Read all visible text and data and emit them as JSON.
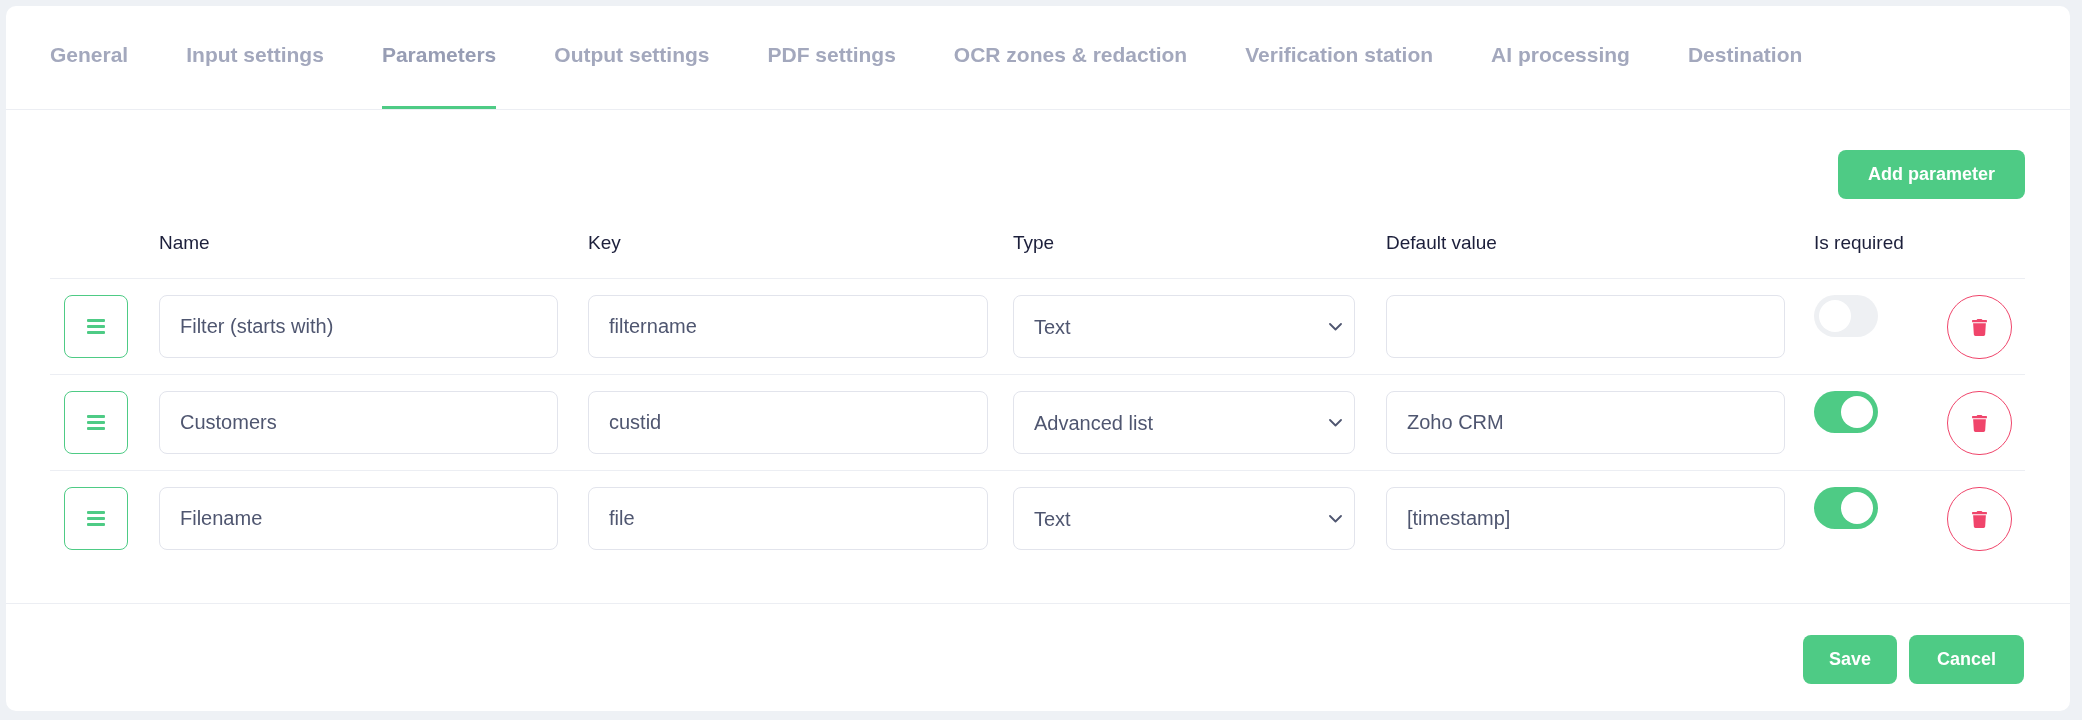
{
  "tabs": [
    {
      "label": "General",
      "selected": false
    },
    {
      "label": "Input settings",
      "selected": false
    },
    {
      "label": "Parameters",
      "selected": true
    },
    {
      "label": "Output settings",
      "selected": false
    },
    {
      "label": "PDF settings",
      "selected": false
    },
    {
      "label": "OCR zones & redaction",
      "selected": false
    },
    {
      "label": "Verification station",
      "selected": false
    },
    {
      "label": "AI processing",
      "selected": false
    },
    {
      "label": "Destination",
      "selected": false
    }
  ],
  "add_button": "Add parameter",
  "table": {
    "columns": [
      "Name",
      "Key",
      "Type",
      "Default value",
      "Is required"
    ],
    "rows": [
      {
        "name": "Filter (starts with)",
        "key": "filtername",
        "type": "Text",
        "is_required": false
      },
      {
        "name": "Customers",
        "key": "custid",
        "type": "Advanced list",
        "default_value": "Zoho CRM",
        "is_required": true
      },
      {
        "name": "Filename",
        "key": "file",
        "type": "Text",
        "default_value": "[timestamp]",
        "is_required": true
      }
    ]
  },
  "footer_buttons": [
    "Save",
    "Cancel"
  ]
}
